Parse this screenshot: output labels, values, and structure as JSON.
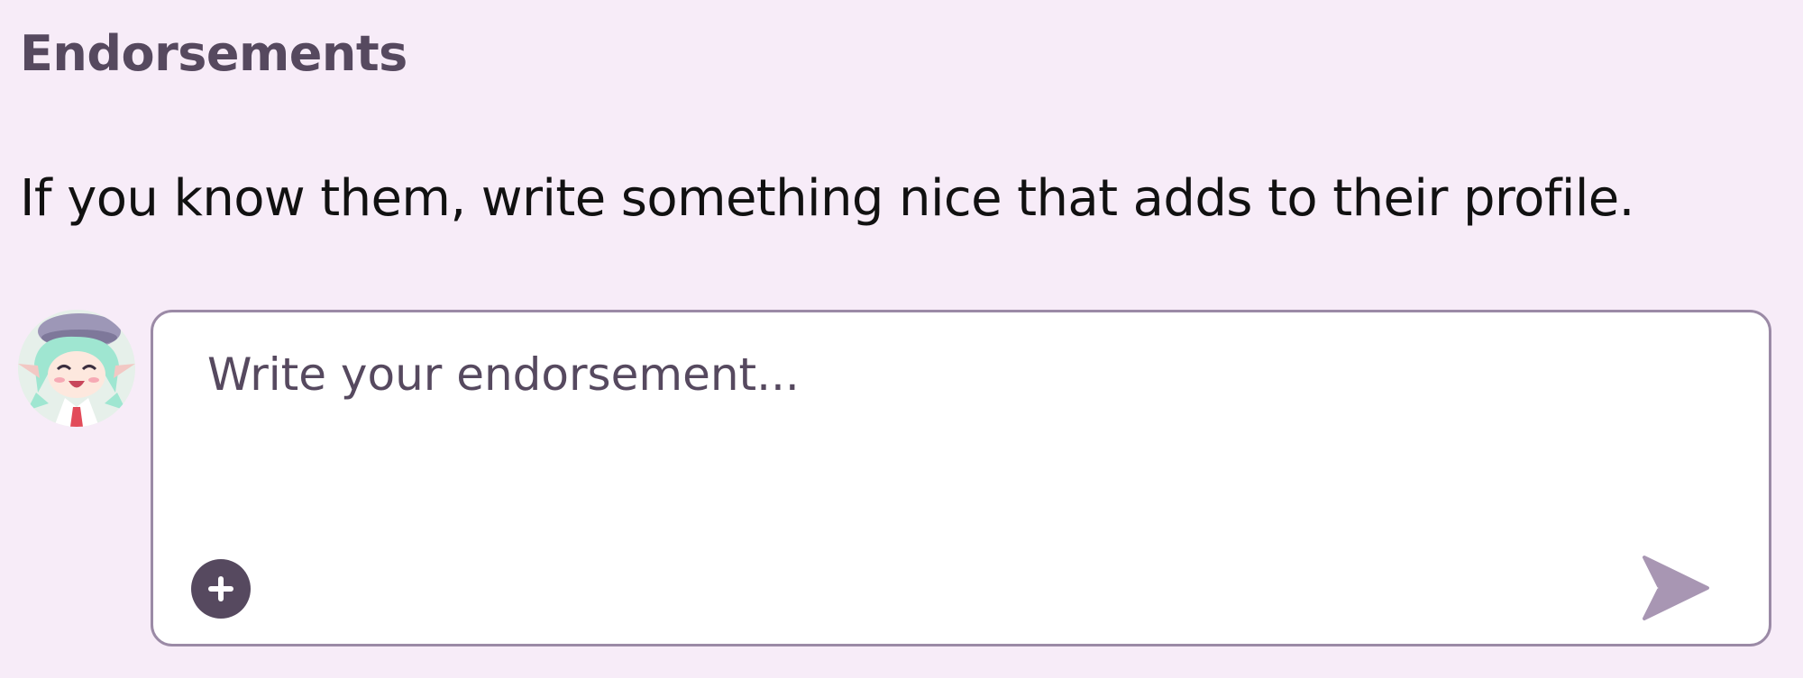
{
  "section": {
    "title": "Endorsements",
    "description": "If you know them, write something nice that adds to their profile."
  },
  "composer": {
    "placeholder": "Write your endorsement...",
    "value": "",
    "add_icon": "plus-circle-icon",
    "send_icon": "send-icon"
  },
  "user": {
    "avatar_icon": "anime-character-avatar"
  },
  "colors": {
    "background": "#f7ecf8",
    "heading": "#56495f",
    "body_text": "#111111",
    "input_border": "#9b8aa6",
    "add_button": "#56495f",
    "send_button": "#a896b3"
  }
}
